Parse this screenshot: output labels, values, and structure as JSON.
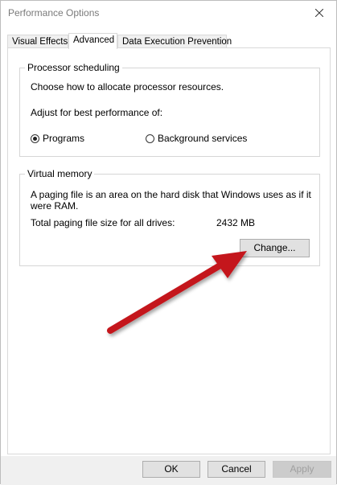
{
  "window": {
    "title": "Performance Options"
  },
  "tabs": [
    {
      "label": "Visual Effects"
    },
    {
      "label": "Advanced"
    },
    {
      "label": "Data Execution Prevention"
    }
  ],
  "processor": {
    "legend": "Processor scheduling",
    "description": "Choose how to allocate processor resources.",
    "adjust_label": "Adjust for best performance of:",
    "options": [
      {
        "label": "Programs",
        "selected": true
      },
      {
        "label": "Background services",
        "selected": false
      }
    ]
  },
  "virtual_memory": {
    "legend": "Virtual memory",
    "description_line1": "A paging file is an area on the hard disk that Windows uses as if it",
    "description_line2": "were RAM.",
    "total_label": "Total paging file size for all drives:",
    "total_value": "2432 MB",
    "change_label": "Change..."
  },
  "footer": {
    "ok_label": "OK",
    "cancel_label": "Cancel",
    "apply_label": "Apply"
  },
  "colors": {
    "annotation_arrow": "#c4151c"
  },
  "icons": {
    "close": "close-icon"
  }
}
